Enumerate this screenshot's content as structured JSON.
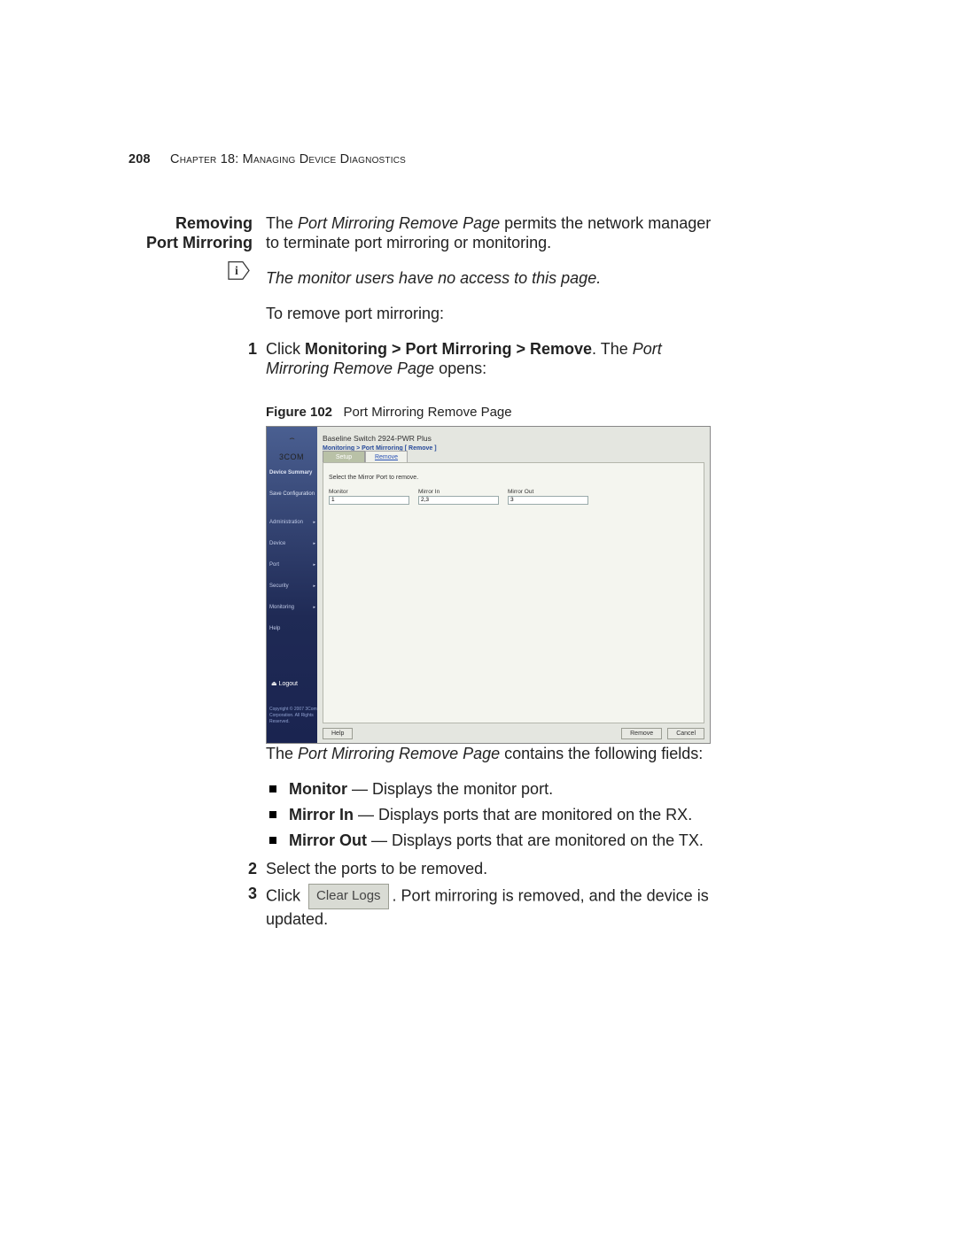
{
  "header": {
    "page_number": "208",
    "chapter_prefix": "C",
    "chapter_word_rest": "hapter",
    "chapter_num": " 18: M",
    "chapter_rest": "anaging",
    "chapter_d": " D",
    "chapter_device": "evice",
    "chapter_sp": " D",
    "chapter_diag": "iagnostics"
  },
  "section_heading": "Removing Port Mirroring",
  "para_intro_pre": "The ",
  "para_intro_em": "Port Mirroring Remove Page",
  "para_intro_post": " permits the network manager to terminate port mirroring or monitoring.",
  "note": "The monitor users have no access to this page.",
  "para_lead": "To remove port mirroring:",
  "step1_num": "1",
  "step1_pre": "Click ",
  "step1_bold": "Monitoring > Port Mirroring > Remove",
  "step1_mid": ". The ",
  "step1_em": "Port Mirroring Remove Page",
  "step1_post": " opens:",
  "figure": {
    "label": "Figure 102",
    "caption": "Port Mirroring Remove Page"
  },
  "ui": {
    "brand": "3COM",
    "device_title": "Baseline Switch 2924-PWR Plus",
    "breadcrumb": "Monitoring > Port Mirroring [ Remove ]",
    "tabs": {
      "setup": "Setup",
      "remove": "Remove"
    },
    "instr": "Select the Mirror Port to remove.",
    "columns": {
      "monitor": "Monitor",
      "mirror_in": "Mirror In",
      "mirror_out": "Mirror Out"
    },
    "row": {
      "monitor": "1",
      "mirror_in": "2,3",
      "mirror_out": "3"
    },
    "sidebar": {
      "device_summary": "Device Summary",
      "save_config": "Save Configuration",
      "administration": "Administration",
      "device": "Device",
      "port": "Port",
      "security": "Security",
      "monitoring": "Monitoring",
      "help": "Help",
      "logout": "Logout",
      "copyright": "Copyright © 2007\n3Com Corporation.\nAll Rights Reserved."
    },
    "buttons": {
      "help": "Help",
      "remove": "Remove",
      "cancel": "Cancel"
    }
  },
  "after_fig_intro_pre": "The ",
  "after_fig_intro_em": "Port Mirroring Remove Page",
  "after_fig_intro_post": " contains the following fields:",
  "bullets": {
    "b1_bold": "Monitor",
    "b1_rest": " — Displays the monitor port.",
    "b2_bold": "Mirror In",
    "b2_rest": " — Displays ports that are monitored on the RX.",
    "b3_bold": "Mirror Out",
    "b3_rest": " — Displays ports that are monitored on the TX."
  },
  "step2_num": "2",
  "step2_text": "Select the ports to be removed.",
  "step3_num": "3",
  "step3_pre": "Click ",
  "step3_btn": "Clear Logs",
  "step3_post": ". Port mirroring is removed, and the device is updated."
}
